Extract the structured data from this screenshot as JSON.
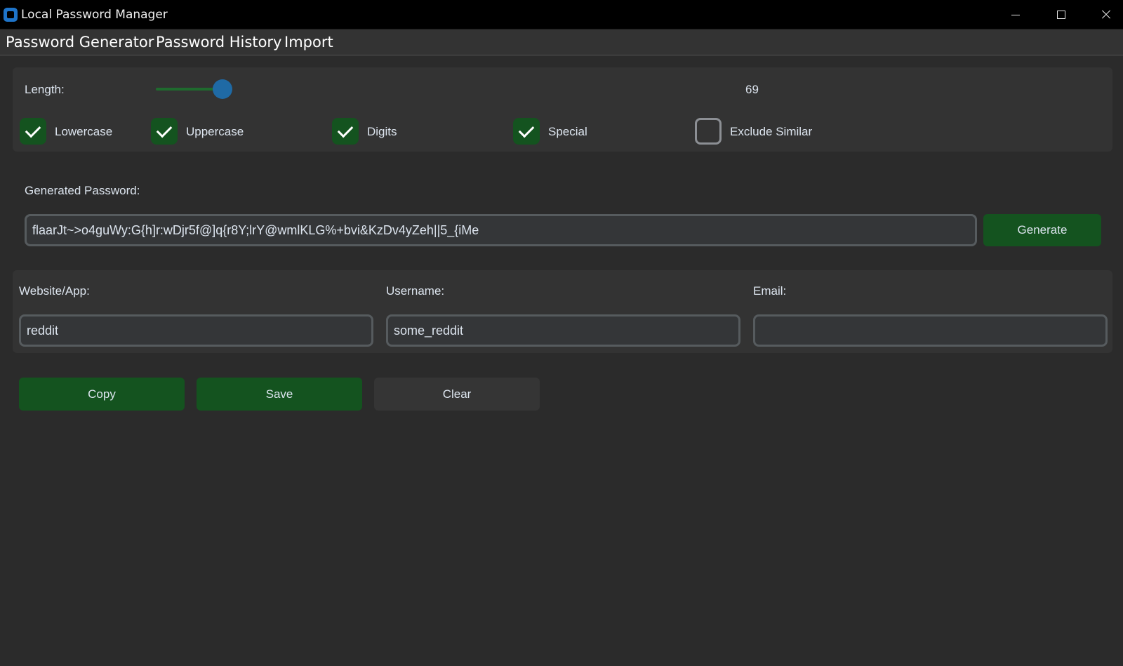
{
  "window": {
    "title": "Local Password Manager"
  },
  "menu": {
    "items": [
      "Password Generator",
      "Password History",
      "Import"
    ]
  },
  "options": {
    "length_label": "Length:",
    "length_value": "69",
    "slider_fraction": 0.9,
    "checkboxes": [
      {
        "label": "Lowercase",
        "checked": true
      },
      {
        "label": "Uppercase",
        "checked": true
      },
      {
        "label": "Digits",
        "checked": true
      },
      {
        "label": "Special",
        "checked": true
      },
      {
        "label": "Exclude Similar",
        "checked": false
      }
    ]
  },
  "password": {
    "label": "Generated Password:",
    "value": "flaarJt~>o4guWy:G{h]r:wDjr5f@]q{r8Y;lrY@wmlKLG%+bvi&KzDv4yZeh||5_{iMe",
    "generate_label": "Generate"
  },
  "account": {
    "website_label": "Website/App:",
    "website_value": "reddit",
    "username_label": "Username:",
    "username_value": "some_reddit",
    "email_label": "Email:",
    "email_value": ""
  },
  "actions": {
    "copy_label": "Copy",
    "save_label": "Save",
    "clear_label": "Clear"
  },
  "colors": {
    "accent_green": "#14531f",
    "slider_blue": "#1f6aa5",
    "background": "#2b2b2b"
  }
}
